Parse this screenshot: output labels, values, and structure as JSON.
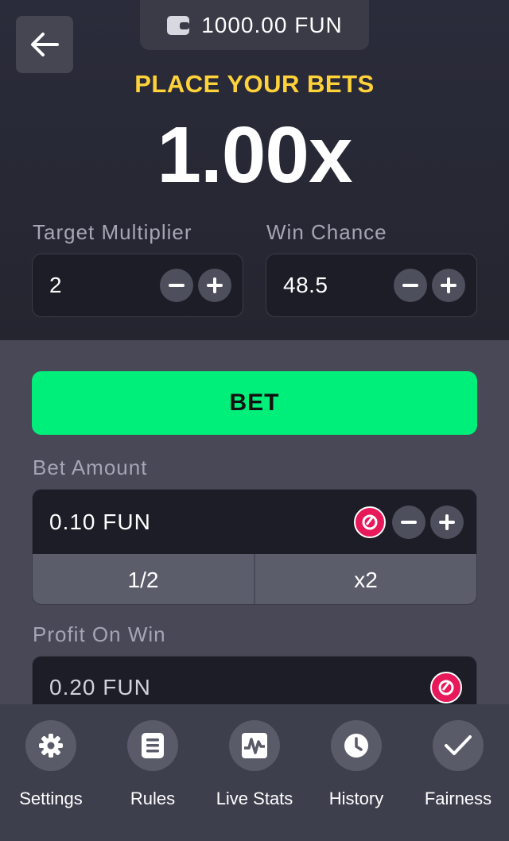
{
  "header": {
    "balance": "1000.00 FUN",
    "headline": "PLACE YOUR BETS",
    "multiplier": "1.00x"
  },
  "target_multiplier": {
    "label": "Target Multiplier",
    "value": "2"
  },
  "win_chance": {
    "label": "Win Chance",
    "value": "48.5"
  },
  "bet_button": {
    "label": "BET"
  },
  "bet_amount": {
    "label": "Bet Amount",
    "value": "0.10 FUN",
    "half_label": "1/2",
    "double_label": "x2"
  },
  "profit_on_win": {
    "label": "Profit On Win",
    "value": "0.20 FUN"
  },
  "nav": [
    {
      "label": "Settings",
      "icon": "gear-icon"
    },
    {
      "label": "Rules",
      "icon": "document-icon"
    },
    {
      "label": "Live Stats",
      "icon": "chart-icon"
    },
    {
      "label": "History",
      "icon": "clock-icon"
    },
    {
      "label": "Fairness",
      "icon": "check-icon"
    }
  ],
  "colors": {
    "accent_green": "#00ee7a",
    "headline_yellow": "#ffd23a",
    "coin_pink": "#e8195a"
  }
}
